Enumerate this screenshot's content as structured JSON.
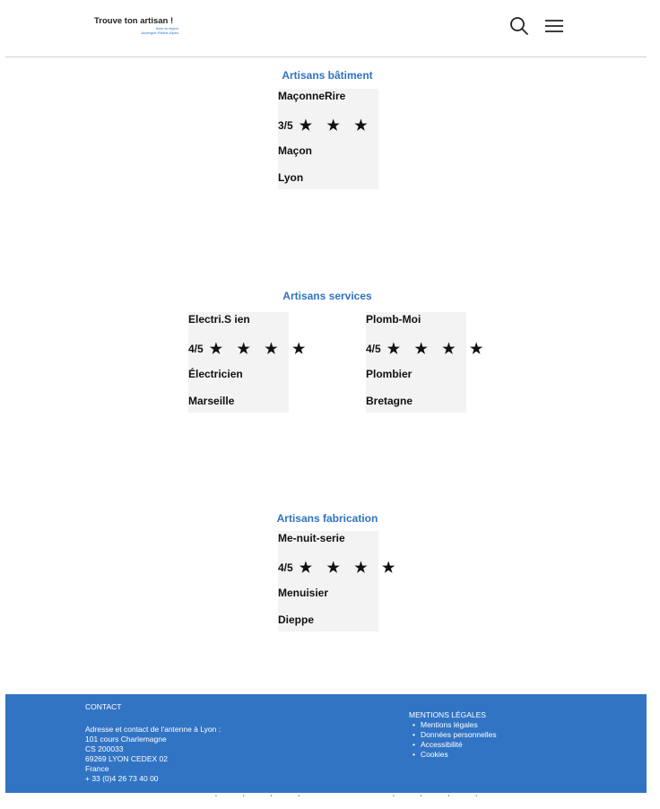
{
  "header": {
    "logo_title": "Trouve ton artisan !",
    "logo_line1": "Avec la région",
    "logo_line2": "Auvergne-Rhône-Alpes",
    "icons": {
      "search": "search-icon",
      "menu": "hamburger-menu-icon"
    }
  },
  "sections": {
    "batiment": {
      "title": "Artisans bâtiment",
      "cards": [
        {
          "name": "MaçonneRire",
          "rating_text": "3/5",
          "stars": "★ ★ ★",
          "rating_value": 3,
          "job": "Maçon",
          "city": "Lyon"
        }
      ]
    },
    "services": {
      "title": "Artisans services",
      "cards": [
        {
          "name": "Electri.S ien",
          "rating_text": "4/5",
          "stars": "★ ★ ★ ★",
          "rating_value": 4,
          "job": "Électricien",
          "city": "Marseille"
        },
        {
          "name": "Plomb-Moi",
          "rating_text": "4/5",
          "stars": "★ ★ ★ ★",
          "rating_value": 4,
          "job": "Plombier",
          "city": "Bretagne"
        }
      ]
    },
    "fabrication": {
      "title": "Artisans fabrication",
      "cards": [
        {
          "name": "Me-nuit-serie",
          "rating_text": "4/5",
          "stars": "★ ★ ★ ★",
          "rating_value": 4,
          "job": "Menuisier",
          "city": "Dieppe"
        }
      ]
    }
  },
  "footer": {
    "contact_title": "CONTACT",
    "address_lines": [
      "Adresse et contact de l'antenne à Lyon :",
      "101 cours Charlemagne",
      "CS 200033",
      "69269 LYON CEDEX 02",
      "France",
      "+ 33 (0)4 26 73 40 00"
    ],
    "legal_title": "MENTIONS LÉGALES",
    "legal_links": [
      "Mentions légales",
      "Données personnelles",
      "Accessibilité",
      "Cookies"
    ],
    "background_color": "#3174c4"
  },
  "colors": {
    "accent": "#2f74c0",
    "card_bg": "#f3f3f3"
  }
}
